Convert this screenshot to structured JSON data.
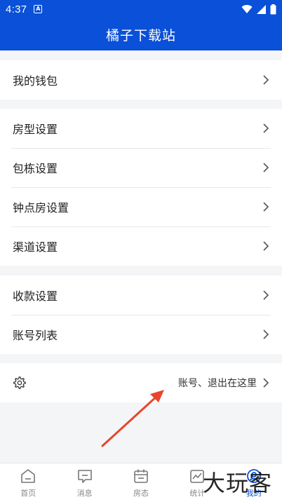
{
  "statusbar": {
    "time": "4:37"
  },
  "header": {
    "title": "橘子下载站"
  },
  "groups": {
    "wallet": {
      "items": [
        {
          "label": "我的钱包"
        }
      ]
    },
    "room": {
      "items": [
        {
          "label": "房型设置"
        },
        {
          "label": "包栋设置"
        },
        {
          "label": "钟点房设置"
        },
        {
          "label": "渠道设置"
        }
      ]
    },
    "account": {
      "items": [
        {
          "label": "收款设置"
        },
        {
          "label": "账号列表"
        }
      ]
    },
    "settings": {
      "hint": "账号、退出在这里"
    }
  },
  "tabs": [
    {
      "label": "首页",
      "icon": "home-icon"
    },
    {
      "label": "消息",
      "icon": "message-icon"
    },
    {
      "label": "房态",
      "icon": "calendar-icon"
    },
    {
      "label": "统计",
      "icon": "chart-icon"
    },
    {
      "label": "我的",
      "icon": "profile-icon",
      "active": true
    }
  ],
  "watermark": {
    "text": "大玩客"
  },
  "colors": {
    "primary": "#0a50d8",
    "annotation_arrow": "#e8452c"
  }
}
